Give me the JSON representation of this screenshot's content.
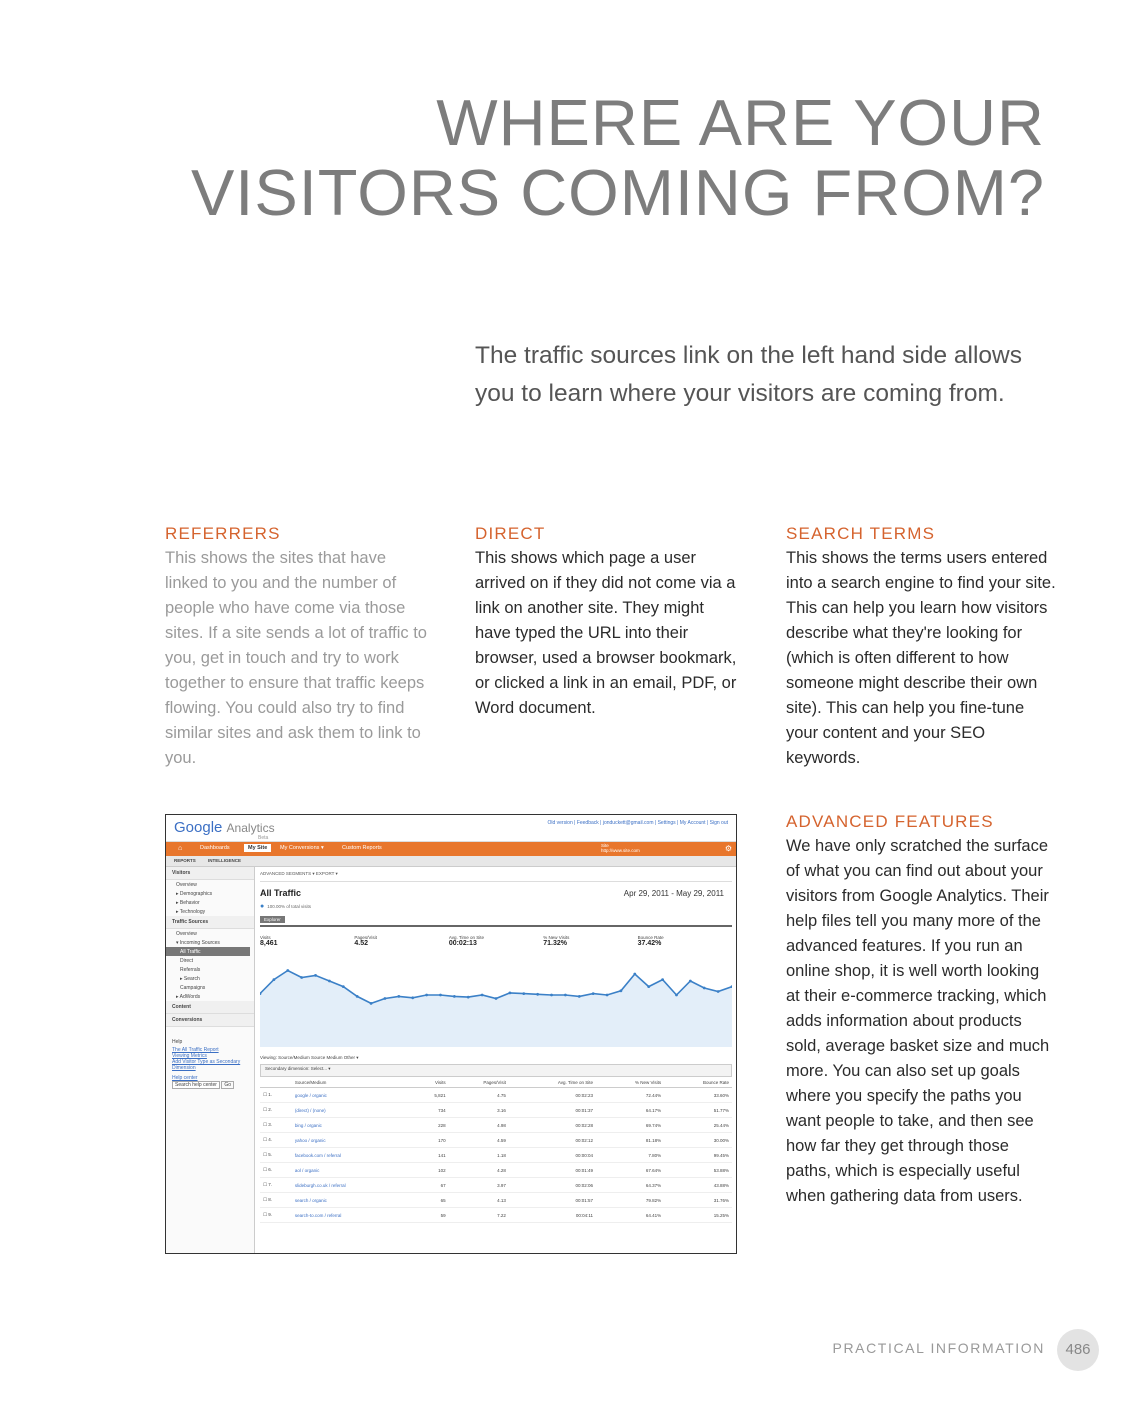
{
  "heading": {
    "line1": "WHERE ARE YOUR",
    "line2": "VISITORS COMING FROM?"
  },
  "intro": "The traffic sources link on the left hand side allows you to learn where your visitors are coming from.",
  "sections": {
    "referrers": {
      "title": "REFERRERS",
      "body": "This shows the sites that have linked to you and the number of people who have come via those sites. If a site sends a lot of traffic to you, get in touch and try to work together to ensure that traffic keeps flowing. You could also try to find similar sites and ask them to link to you."
    },
    "direct": {
      "title": "DIRECT",
      "body": "This shows which page a user arrived on if they did not come via a link on another site. They might have typed the URL into their browser, used a browser bookmark, or clicked a link in an email, PDF, or Word document."
    },
    "search": {
      "title": "SEARCH TERMS",
      "body": "This shows the terms users entered into a search engine to find your site. This can help you learn how visitors describe what they're looking for (which is often different to how someone might describe their own site). This can help you fine-tune your content and your SEO keywords."
    },
    "advanced": {
      "title": "ADVANCED FEATURES",
      "body": "We have only scratched the surface of what you can find out about your visitors from Google Analytics. Their help files tell you many more of the advanced features. If you run an online shop, it is well worth looking at their e-commerce tracking, which adds information about products sold, average basket size and much more. You can also set up goals where you specify the paths you want people to take, and then see how far they get through those paths, which is especially useful when gathering data from users."
    }
  },
  "screenshot": {
    "logo_google": "Google",
    "logo_analytics": "Analytics",
    "beta": "Beta",
    "top_links": "Old version | Feedback | jonduckett@gmail.com | Settings | My Account | Sign out",
    "tabs": [
      "Dashboards",
      "My Site",
      "My Conversions ▾",
      "Custom Reports"
    ],
    "site_label": "Site",
    "site_url": "http://www.site.com",
    "subtabs": [
      "REPORTS",
      "INTELLIGENCE"
    ],
    "sidebar": {
      "visitors": "Visitors",
      "visitors_items": [
        "Overview",
        "▸ Demographics",
        "▸ Behavior",
        "▸ Technology"
      ],
      "traffic": "Traffic Sources",
      "traffic_items": [
        "Overview",
        "▾ Incoming Sources"
      ],
      "traffic_sub": [
        "All Traffic",
        "Direct",
        "Referrals",
        "▸ Search",
        "Campaigns"
      ],
      "adwords": "▸ AdWords",
      "content": "Content",
      "conversions": "Conversions",
      "help": "Help",
      "help_links": [
        "The All Traffic Report",
        "Viewing Metrics",
        "Add Visitor Type as Secondary Dimension"
      ],
      "help_center": "Help center",
      "search_help": "Search help center",
      "go": "Go"
    },
    "segments": "ADVANCED SEGMENTS ▾    EXPORT ▾",
    "report_title": "All Traffic",
    "date_range": "Apr 29, 2011 - May 29, 2011",
    "pct_visits": "100.00% of total visits",
    "explorer": "Explorer",
    "metrics": [
      {
        "label": "Visits",
        "value": "8,461"
      },
      {
        "label": "Pages/Visit",
        "value": "4.52"
      },
      {
        "label": "Avg. Time on Site",
        "value": "00:02:13"
      },
      {
        "label": "% New Visits",
        "value": "71.32%"
      },
      {
        "label": "Bounce Rate",
        "value": "37.42%"
      }
    ],
    "viewing": "Viewing: Source/Medium  Source  Medium  Other ▾",
    "tools": "Secondary dimension: Select... ▾",
    "columns": [
      "Source/Medium",
      "Visits",
      "Pages/Visit",
      "Avg. Time on Site",
      "% New Visits",
      "Bounce Rate"
    ],
    "rows": [
      [
        "1.",
        "google / organic",
        "5,821",
        "4.75",
        "00:02:23",
        "72.44%",
        "33.60%"
      ],
      [
        "2.",
        "(direct) / (none)",
        "734",
        "3.16",
        "00:01:37",
        "64.17%",
        "51.77%"
      ],
      [
        "3.",
        "bing / organic",
        "228",
        "4.98",
        "00:02:28",
        "69.74%",
        "25.44%"
      ],
      [
        "4.",
        "yahoo / organic",
        "170",
        "4.59",
        "00:02:12",
        "81.18%",
        "30.00%"
      ],
      [
        "5.",
        "facebook.com / referral",
        "141",
        "1.18",
        "00:00:04",
        "7.80%",
        "99.45%"
      ],
      [
        "6.",
        "aol / organic",
        "102",
        "4.28",
        "00:01:49",
        "67.64%",
        "53.88%"
      ],
      [
        "7.",
        "slideburgh.co.uk / referral",
        "67",
        "3.97",
        "00:02:06",
        "64.37%",
        "43.88%"
      ],
      [
        "8.",
        "search / organic",
        "65",
        "4.13",
        "00:01:57",
        "79.82%",
        "31.76%"
      ],
      [
        "9.",
        "search-to.com / referral",
        "59",
        "7.22",
        "00:04:11",
        "64.41%",
        "15.25%"
      ]
    ],
    "chart_data": {
      "type": "line",
      "series": [
        {
          "values": [
            0.62,
            0.82,
            0.95,
            0.85,
            0.88,
            0.8,
            0.72,
            0.58,
            0.48,
            0.55,
            0.58,
            0.56,
            0.6,
            0.6,
            0.58,
            0.57,
            0.6,
            0.55,
            0.63,
            0.62,
            0.61,
            0.6,
            0.6,
            0.58,
            0.62,
            0.6,
            0.66,
            0.9,
            0.72,
            0.82,
            0.6,
            0.8,
            0.7,
            0.65,
            0.72
          ]
        }
      ]
    }
  },
  "footer": {
    "label": "PRACTICAL INFORMATION",
    "page": "486"
  }
}
